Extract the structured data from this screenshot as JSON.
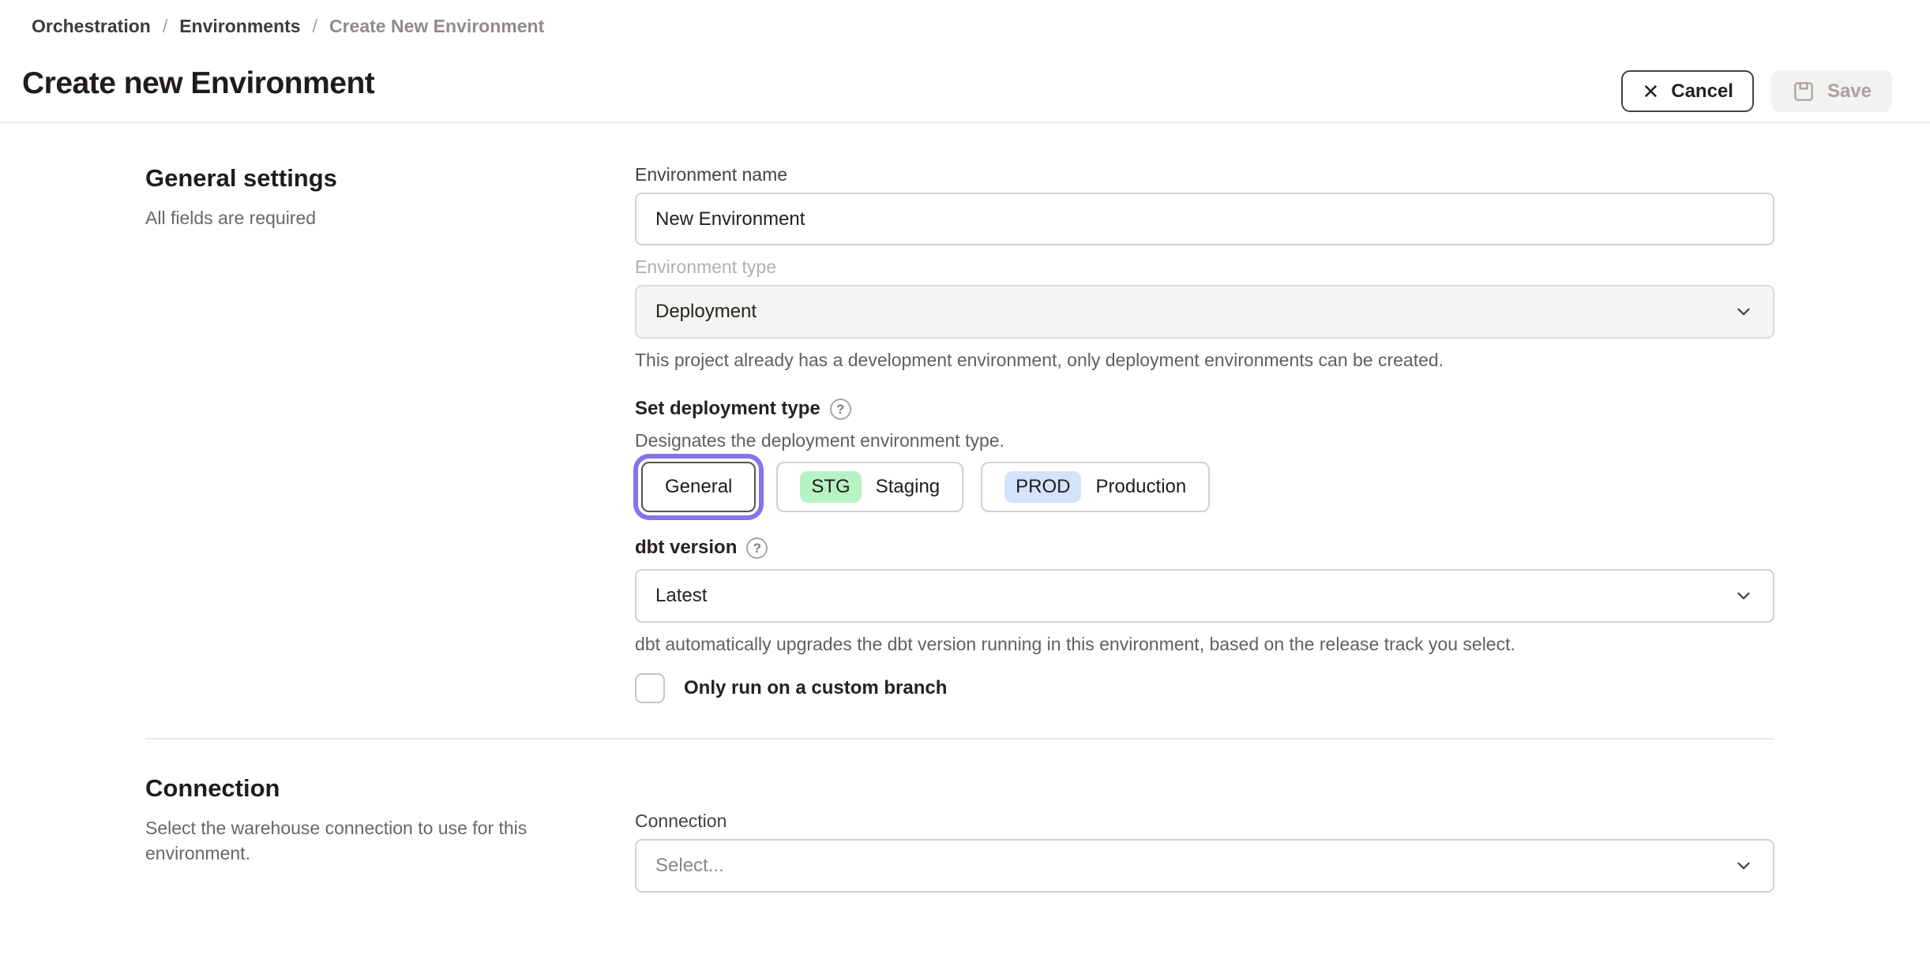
{
  "breadcrumb": {
    "items": [
      "Orchestration",
      "Environments",
      "Create New Environment"
    ],
    "separator": "/"
  },
  "header": {
    "title": "Create new Environment",
    "cancel_label": "Cancel",
    "save_label": "Save",
    "save_disabled": true
  },
  "icons": {
    "close_glyph": "✕",
    "help_glyph": "?"
  },
  "general": {
    "heading": "General settings",
    "subheading": "All fields are required",
    "environment_name": {
      "label": "Environment name",
      "value": "New Environment"
    },
    "environment_type": {
      "label": "Environment type",
      "value": "Deployment",
      "disabled": true,
      "helper": "This project already has a development environment, only deployment environments can be created."
    },
    "deployment_type": {
      "label": "Set deployment type",
      "helper": "Designates the deployment environment type.",
      "options": [
        {
          "label": "General",
          "badge": "",
          "selected": true
        },
        {
          "label": "Staging",
          "badge": "STG",
          "selected": false
        },
        {
          "label": "Production",
          "badge": "PROD",
          "selected": false
        }
      ]
    },
    "dbt_version": {
      "label": "dbt version",
      "value": "Latest",
      "helper": "dbt automatically upgrades the dbt version running in this environment, based on the release track you select."
    },
    "custom_branch": {
      "label": "Only run on a custom branch",
      "checked": false
    }
  },
  "connection": {
    "heading": "Connection",
    "subheading": "Select the warehouse connection to use for this environment.",
    "field_label": "Connection",
    "placeholder": "Select..."
  },
  "colors": {
    "accent": "#8573EA",
    "staging_badge": "#B7F2C3",
    "production_badge": "#D2E3FB",
    "save_disabled_bg": "#F3F2F0",
    "save_disabled_text": "#A7A39D",
    "text_primary": "#25221E",
    "text_muted": "#63605A"
  }
}
